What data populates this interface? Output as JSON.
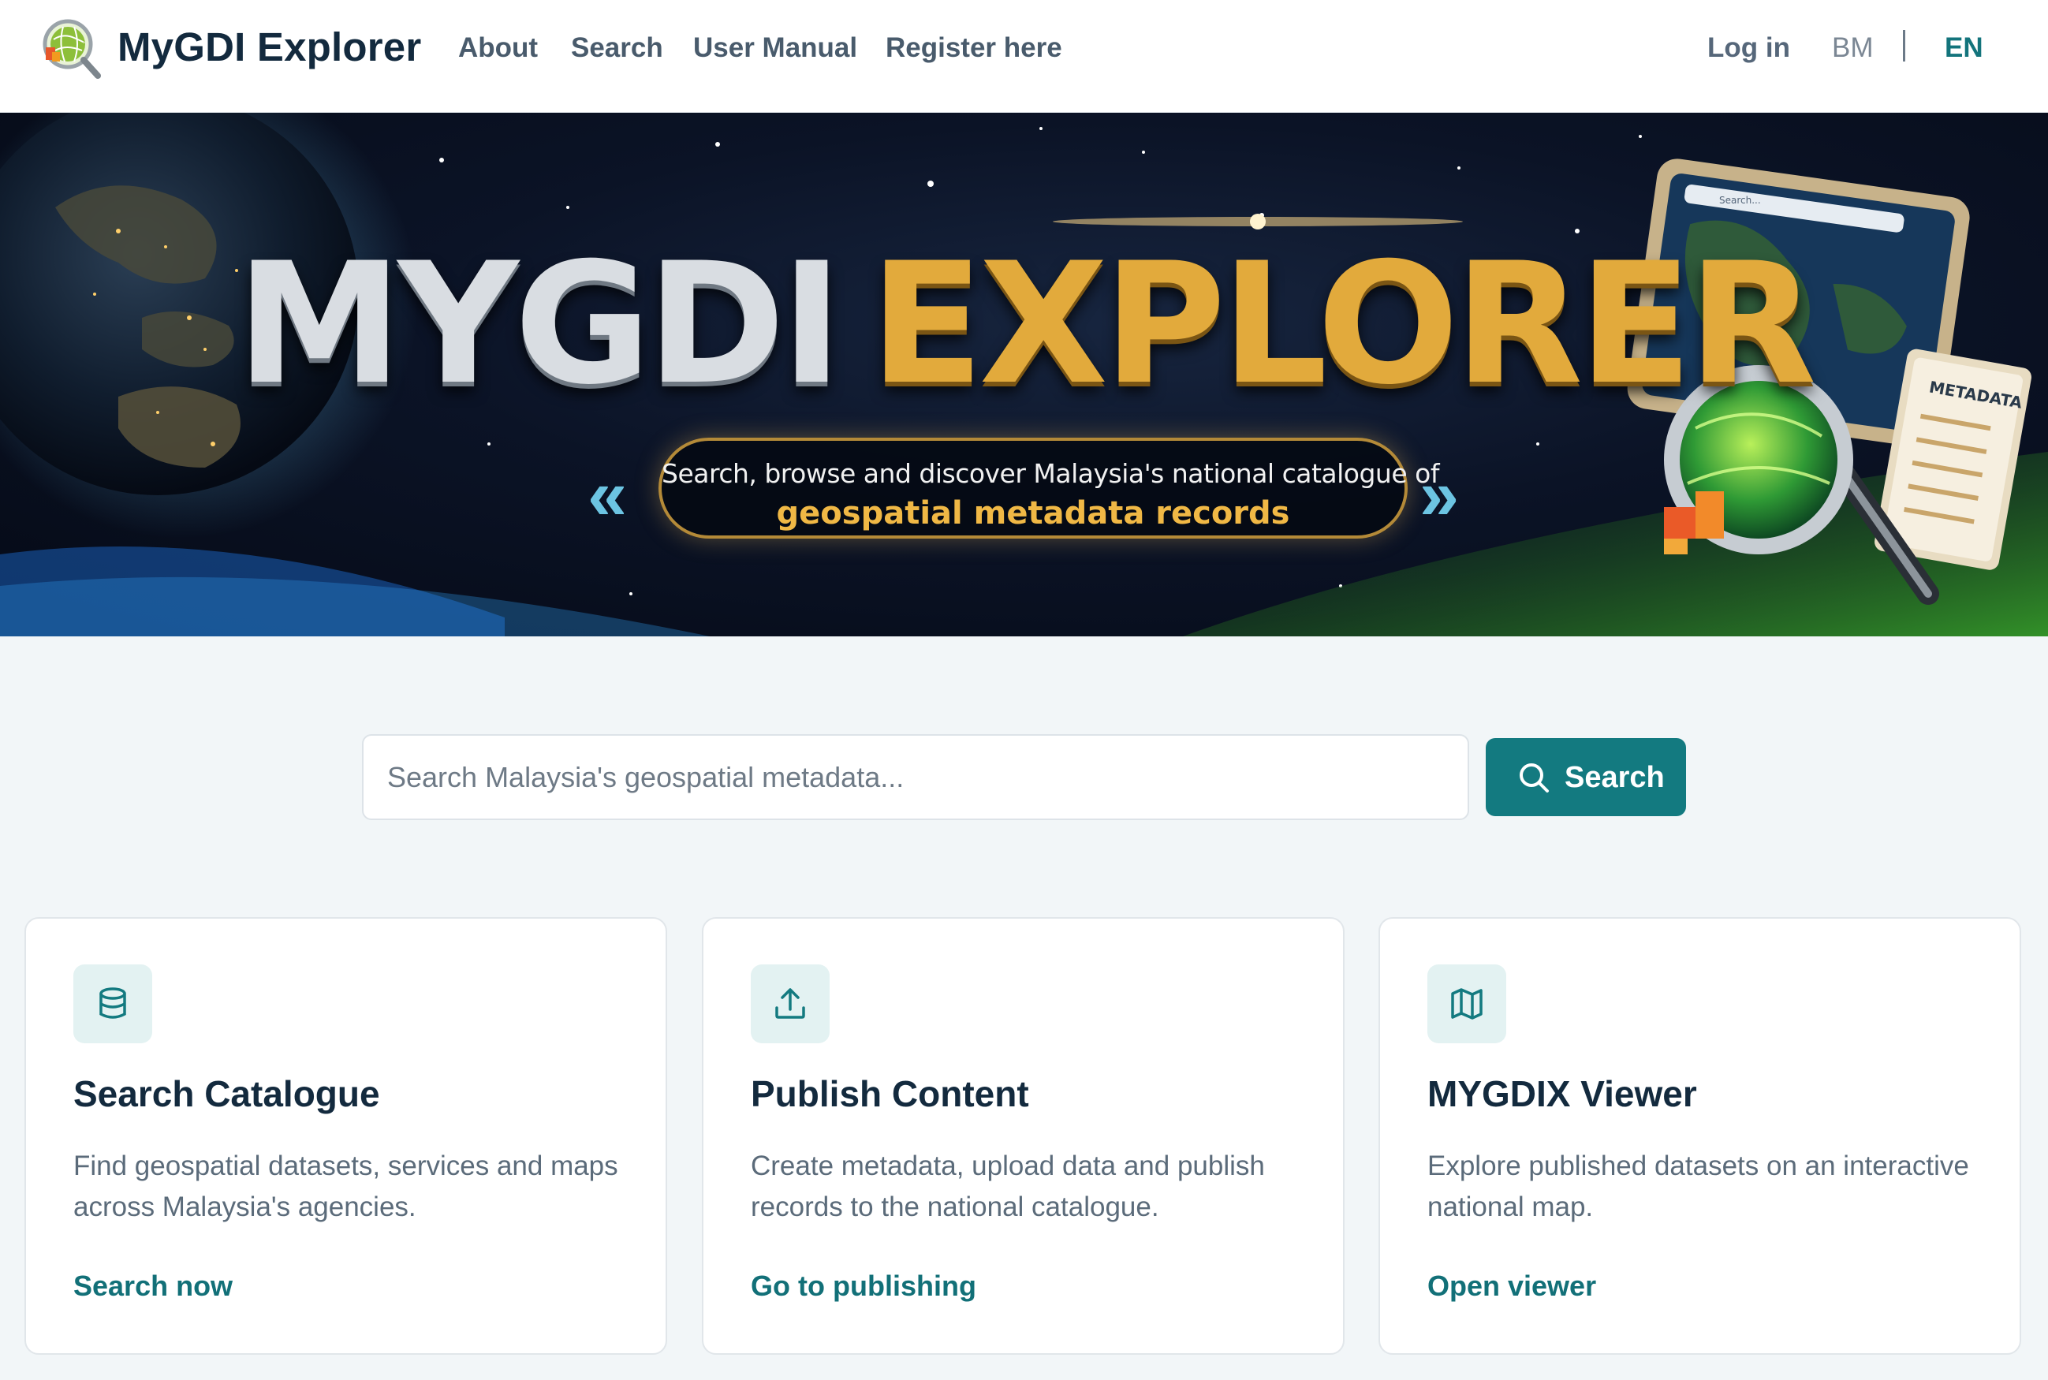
{
  "header": {
    "brand": "MyGDI Explorer",
    "nav": [
      "About",
      "Search",
      "User Manual",
      "Register here"
    ],
    "login": "Log in",
    "lang_bm": "BM",
    "lang_en": "EN"
  },
  "hero": {
    "title_part1": "MYGDI",
    "title_part2": "EXPLORER",
    "subtitle_line1": "Search, browse and discover Malaysia's national catalogue of",
    "subtitle_line2": "geospatial metadata records",
    "panel_label": "METADATA",
    "panel_search": "Search..."
  },
  "search": {
    "placeholder": "Search Malaysia's geospatial metadata...",
    "button_label": "Search"
  },
  "cards": [
    {
      "icon": "database-icon",
      "title": "Search Catalogue",
      "description": "Find geospatial datasets, services and maps across Malaysia's agencies.",
      "link": "Search now"
    },
    {
      "icon": "upload-icon",
      "title": "Publish Content",
      "description": "Create metadata, upload data and publish records to the national catalogue.",
      "link": "Go to publishing"
    },
    {
      "icon": "map-icon",
      "title": "MYGDIX Viewer",
      "description": "Explore published datasets on an interactive national map.",
      "link": "Open viewer"
    }
  ],
  "colors": {
    "accent": "#137a80",
    "link": "#127078",
    "hero_gold": "#e2aa3c"
  }
}
